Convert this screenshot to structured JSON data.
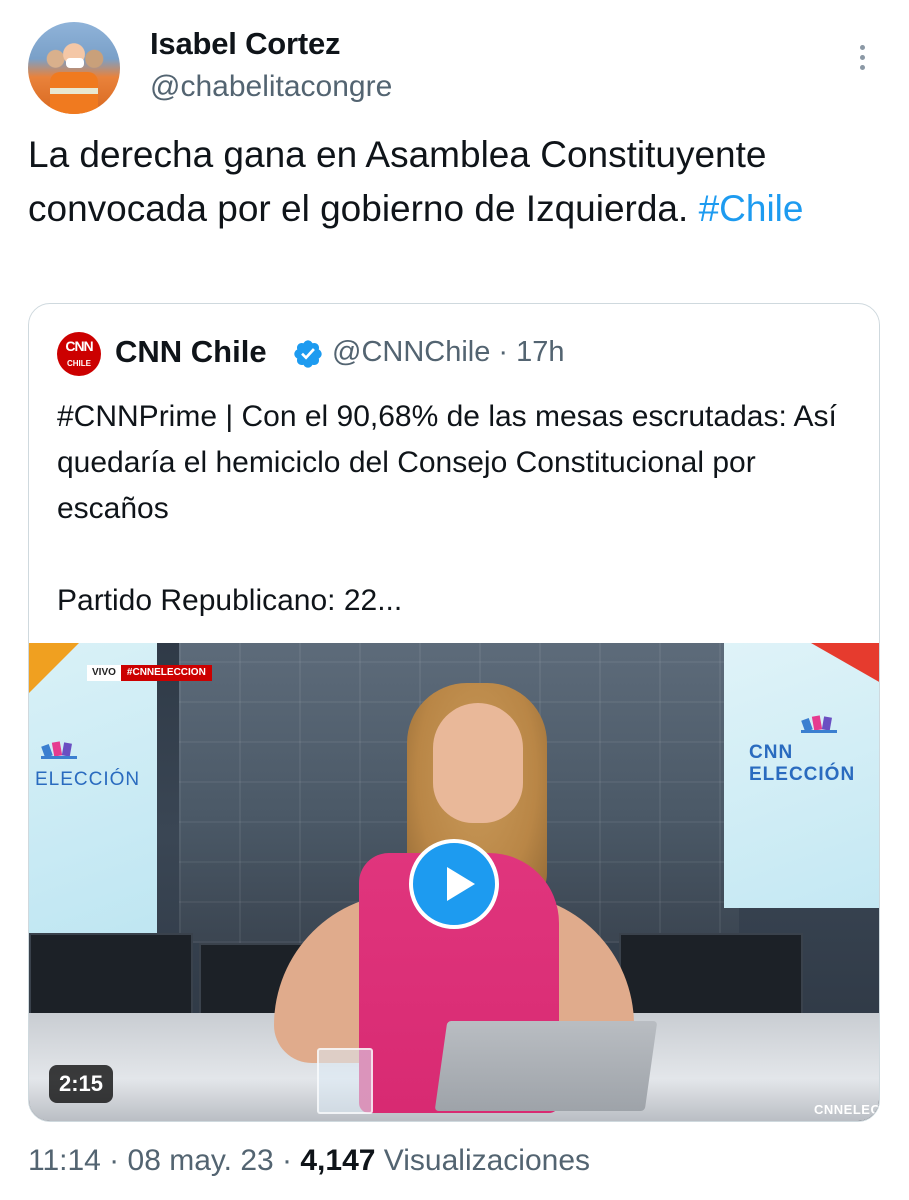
{
  "author": {
    "name": "Isabel Cortez",
    "handle": "@chabelitacongre"
  },
  "tweet": {
    "text": "La derecha gana en Asamblea Constituyente convocada por el gobierno de Izquierda. ",
    "hashtag": "#Chile"
  },
  "quote": {
    "logo_line1": "CNN",
    "logo_line2": "CHILE",
    "name": "CNN Chile",
    "handle_time": "@CNNChile · 17h",
    "text": "#CNNPrime | Con el 90,68% de las mesas escrutadas: Así quedaría el hemiciclo del Consejo Constitucional por escaños\n\nPartido Republicano: 22...",
    "video": {
      "live_label": "VIVO",
      "live_tag": "#CNNELECCION",
      "left_screen_text": "ELECCIÓN",
      "right_screen_text": "CNN ELECCIÓN",
      "bottom_right_text": "CNNELEC",
      "duration": "2:15"
    }
  },
  "meta": {
    "time": "11:14 · 08 may. 23 · ",
    "views_count": "4,147",
    "views_label": " Visualizaciones"
  },
  "colors": {
    "accent": "#1d9bf0",
    "secondary_text": "#536471",
    "cnn_red": "#cc0000",
    "dress_pink": "#d82a72"
  },
  "icons": [
    "more-icon",
    "verified-icon",
    "play-icon"
  ]
}
